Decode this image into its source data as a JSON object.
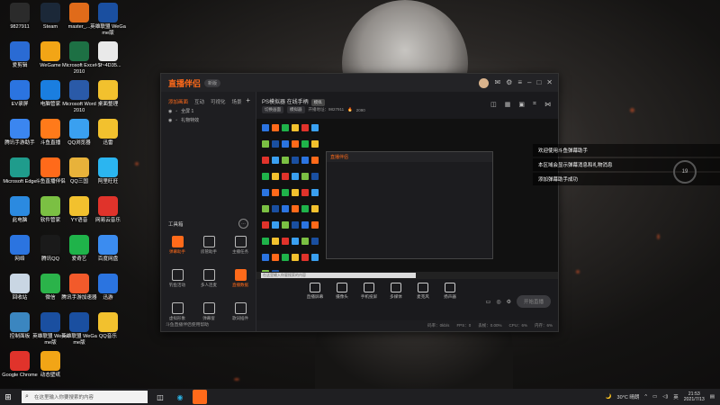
{
  "desktop_icons": [
    {
      "label": "9827911",
      "icon": "user-icon",
      "color": "#2b2b2b"
    },
    {
      "label": "Steam",
      "icon": "steam-icon",
      "color": "#1b2838"
    },
    {
      "label": "master_...",
      "icon": "folder-icon",
      "color": "#e06b1a"
    },
    {
      "label": "英雄联盟 WeGame版",
      "icon": "lol-icon",
      "color": "#1a4fa0"
    },
    {
      "label": "爱剪辑",
      "icon": "scissors-icon",
      "color": "#2a6bd4"
    },
    {
      "label": "WeGame",
      "icon": "wegame-icon",
      "color": "#f2a516"
    },
    {
      "label": "Microsoft Excel 2010",
      "icon": "excel-icon",
      "color": "#1d7044"
    },
    {
      "label": "~$f~4D35...",
      "icon": "file-icon",
      "color": "#e9e9e9"
    },
    {
      "label": "EV录屏",
      "icon": "record-icon",
      "color": "#2b74e0"
    },
    {
      "label": "电脑管家",
      "icon": "shield-icon",
      "color": "#1a7ee0"
    },
    {
      "label": "Microsoft Word 2010",
      "icon": "word-icon",
      "color": "#2a5aa8"
    },
    {
      "label": "桌面整理",
      "icon": "desk-icon",
      "color": "#f2c12e"
    },
    {
      "label": "腾讯手游助手",
      "icon": "gamepad-icon",
      "color": "#3b86f0"
    },
    {
      "label": "斗鱼直播",
      "icon": "douyu-icon",
      "color": "#ff7a1a"
    },
    {
      "label": "QQ浏览器",
      "icon": "qqbrowser-icon",
      "color": "#3aa0f0"
    },
    {
      "label": "迅雷",
      "icon": "thunder-icon",
      "color": "#f2c12e"
    },
    {
      "label": "Microsoft Edge",
      "icon": "edge-icon",
      "color": "#1f9c8c"
    },
    {
      "label": "斗鱼直播伴侣",
      "icon": "douyu-companion-icon",
      "color": "#ff6a1a"
    },
    {
      "label": "QQ三国",
      "icon": "qqsanguo-icon",
      "color": "#e8b23a"
    },
    {
      "label": "阿里旺旺",
      "icon": "aliwangwang-icon",
      "color": "#2bb5f0"
    },
    {
      "label": "此电脑",
      "icon": "computer-icon",
      "color": "#2b8ae0"
    },
    {
      "label": "软件管家",
      "icon": "pinwheel-icon",
      "color": "#7bc043"
    },
    {
      "label": "YY语音",
      "icon": "yy-icon",
      "color": "#f2c12e"
    },
    {
      "label": "网易云音乐",
      "icon": "music-icon",
      "color": "#e0332b"
    },
    {
      "label": "网络",
      "icon": "network-icon",
      "color": "#2b74e0"
    },
    {
      "label": "腾讯QQ",
      "icon": "qq-icon",
      "color": "#1a1a1a"
    },
    {
      "label": "爱奇艺",
      "icon": "iqiyi-icon",
      "color": "#1fb34a"
    },
    {
      "label": "百度网盘",
      "icon": "cloud-icon",
      "color": "#3b8cf0"
    },
    {
      "label": "回收站",
      "icon": "recycle-bin-icon",
      "color": "#c9d6e3"
    },
    {
      "label": "微信",
      "icon": "wechat-icon",
      "color": "#2bb34a"
    },
    {
      "label": "腾讯手游加速器",
      "icon": "accelerator-icon",
      "color": "#f25a2b"
    },
    {
      "label": "迅游",
      "icon": "xunyou-icon",
      "color": "#2b74e0"
    },
    {
      "label": "控制面板",
      "icon": "control-panel-icon",
      "color": "#3b86c0"
    },
    {
      "label": "英雄联盟 WeGame版",
      "icon": "lol-icon",
      "color": "#1a4fa0"
    },
    {
      "label": "英雄联盟 WeGame版",
      "icon": "lol-icon",
      "color": "#1a4fa0"
    },
    {
      "label": "QQ音乐",
      "icon": "qqmusic-icon",
      "color": "#f2c12e"
    },
    {
      "label": "Google Chrome",
      "icon": "chrome-icon",
      "color": "#e0332b"
    },
    {
      "label": "动态壁纸",
      "icon": "wallpaper-icon",
      "color": "#f2a516"
    }
  ],
  "app": {
    "logo": "直播伴侣",
    "version": "新版",
    "tabs": [
      "添加画面",
      "互动",
      "可视化",
      "场景"
    ],
    "scenes": [
      "全屏 1",
      "礼物特效"
    ],
    "tools_title": "工具箱",
    "tools": [
      {
        "label": "弹幕助手",
        "orange": true
      },
      {
        "label": "房管助手",
        "orange": false
      },
      {
        "label": "主播任务",
        "orange": false
      },
      {
        "label": "钓鱼活动",
        "orange": false
      },
      {
        "label": "多人连麦",
        "orange": false
      },
      {
        "label": "直播数据",
        "orange": true
      },
      {
        "label": "虚拟形象",
        "orange": false
      },
      {
        "label": "弹幕窗",
        "orange": false
      },
      {
        "label": "歌词插件",
        "orange": false
      }
    ],
    "bottom_notice": "斗鱼直播伴侣使用帮助",
    "room_title": "PS模拟器 在线手柄",
    "room_tag": "模拟",
    "room_meta": [
      "切换画面",
      "模拟器",
      "开播地址：9827911",
      "2090"
    ],
    "controls": [
      "直播屏幕",
      "摄像头",
      "手机投屏",
      "多媒体",
      "麦克风",
      "扬声器"
    ],
    "start_label": "开始直播",
    "status": [
      "码率：0kb/s",
      "FPS：0",
      "丢帧：0.00%",
      "CPU：6%",
      "内存：6%"
    ]
  },
  "danmu": [
    "欢迎使用斗鱼弹幕助手",
    "本区域会显示弹幕消息和礼物消息",
    "添加弹幕助手成功"
  ],
  "ring_value": "19",
  "taskbar": {
    "search_placeholder": "在这里输入你要搜索的内容",
    "weather": "30°C 晴朗",
    "time": "21:53",
    "date": "2021/7/13"
  }
}
